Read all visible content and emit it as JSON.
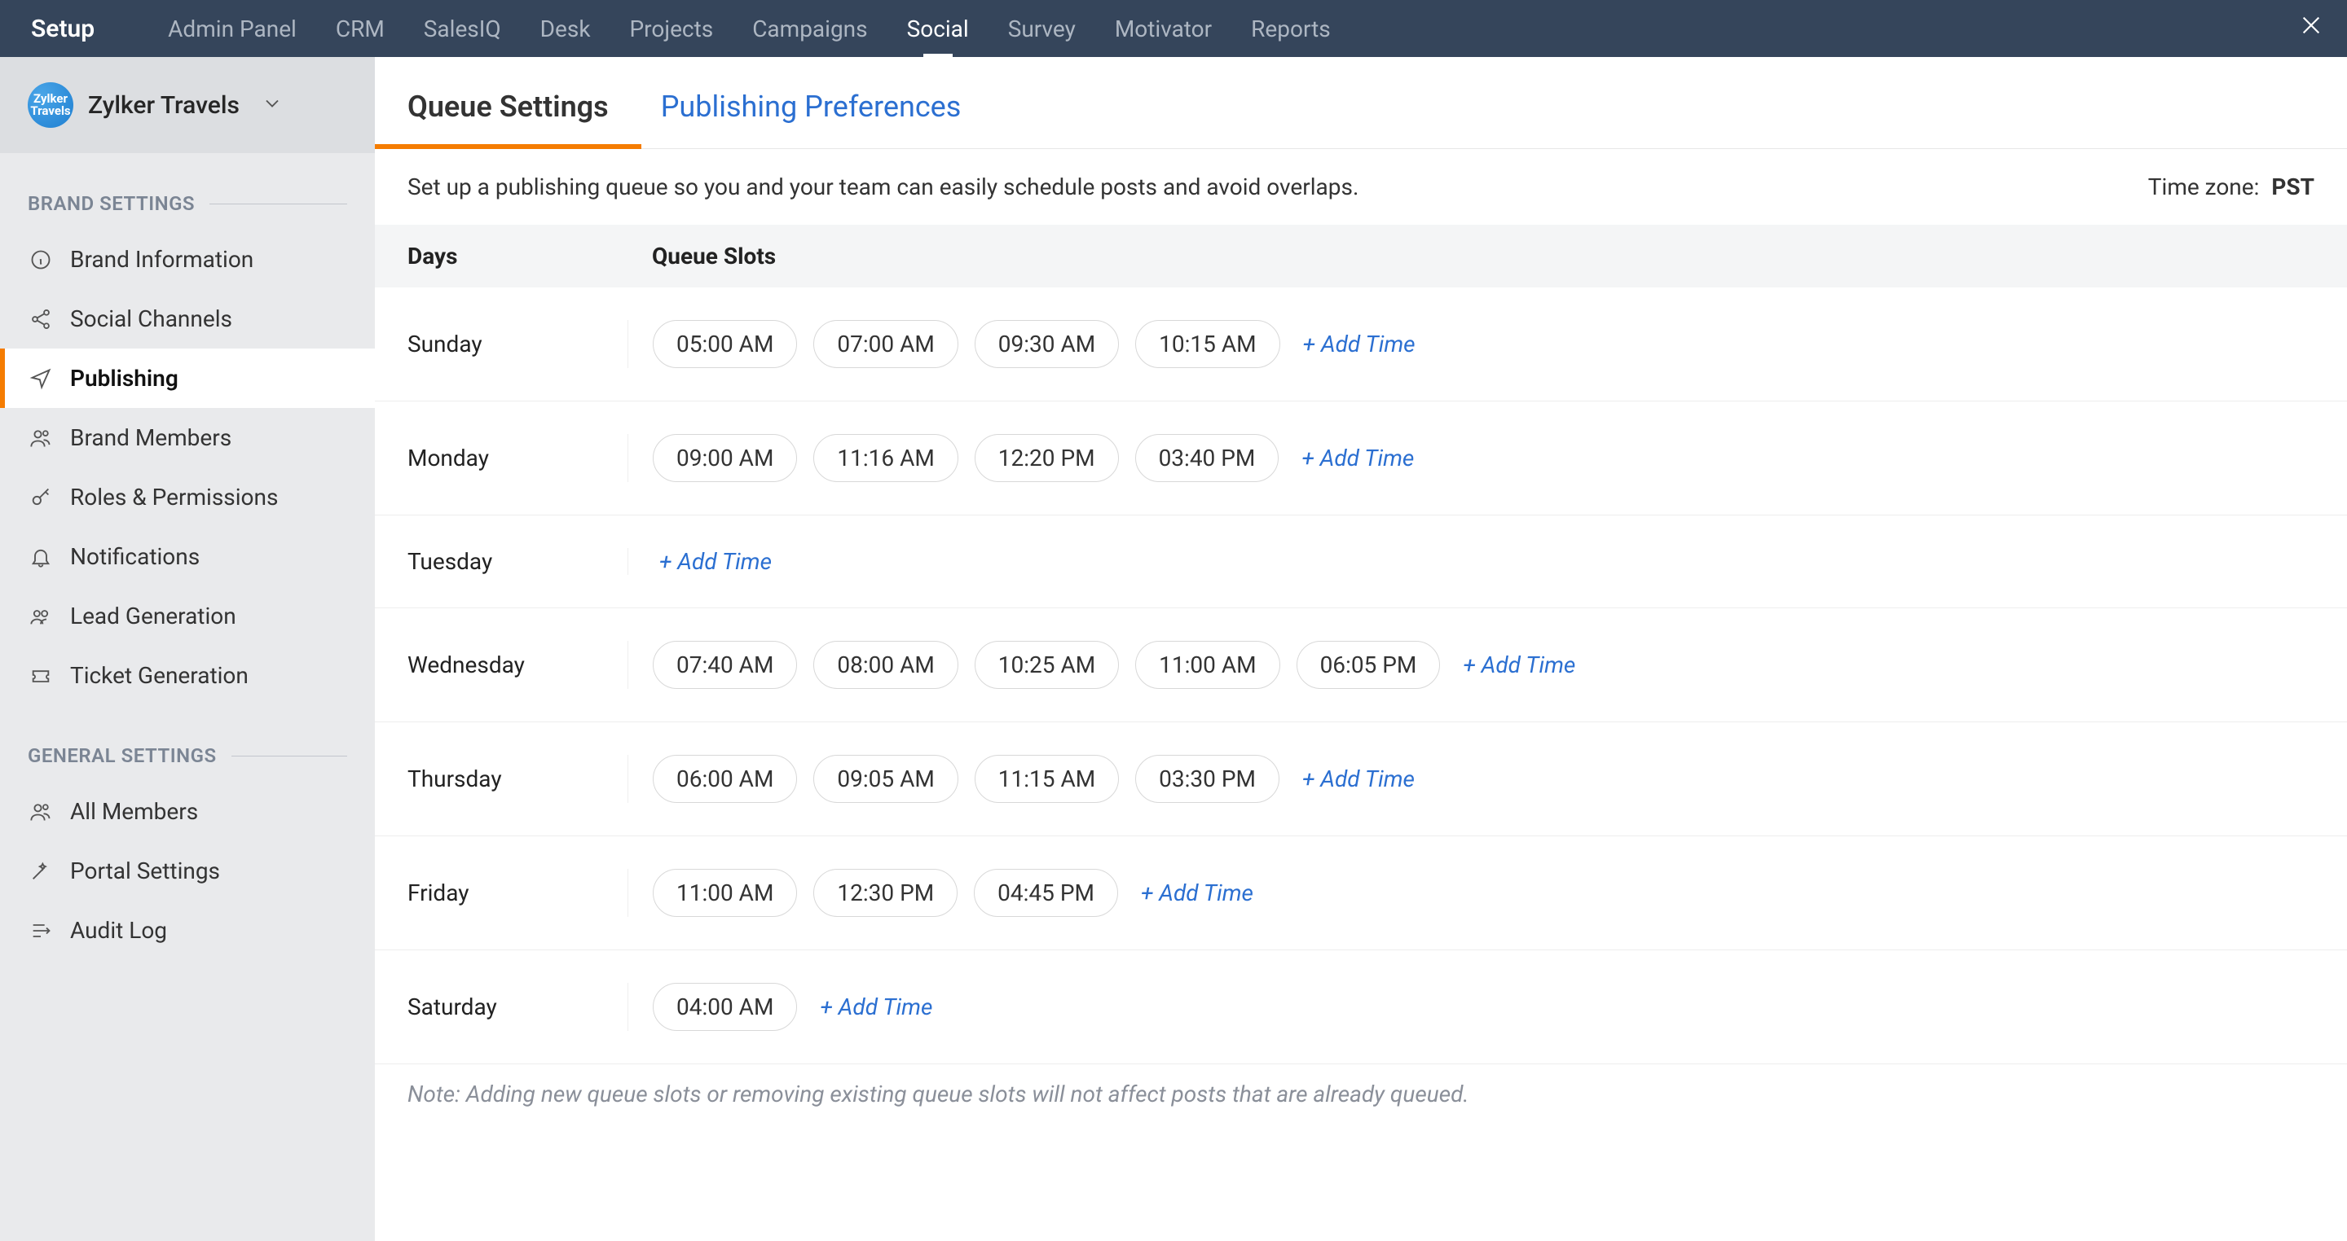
{
  "topbar": {
    "setup": "Setup",
    "items": [
      "Admin Panel",
      "CRM",
      "SalesIQ",
      "Desk",
      "Projects",
      "Campaigns",
      "Social",
      "Survey",
      "Motivator",
      "Reports"
    ],
    "active_index": 6
  },
  "brand": {
    "name": "Zylker Travels",
    "logo_text": "Zylker Travels"
  },
  "sidebar": {
    "section_brand": "BRAND SETTINGS",
    "brand_items": [
      "Brand Information",
      "Social Channels",
      "Publishing",
      "Brand Members",
      "Roles & Permissions",
      "Notifications",
      "Lead Generation",
      "Ticket Generation"
    ],
    "brand_icons": [
      "info-icon",
      "share-icon",
      "send-icon",
      "members-icon",
      "key-icon",
      "bell-icon",
      "people-icon",
      "ticket-icon"
    ],
    "brand_active_index": 2,
    "section_general": "GENERAL SETTINGS",
    "general_items": [
      "All Members",
      "Portal Settings",
      "Audit Log"
    ],
    "general_icons": [
      "members-icon",
      "wand-icon",
      "log-icon"
    ]
  },
  "tabs": {
    "queue": "Queue Settings",
    "pref": "Publishing Preferences"
  },
  "desc": "Set up a publishing queue so you and your team can easily schedule posts and avoid overlaps.",
  "tz": {
    "label": "Time zone:",
    "value": "PST"
  },
  "head": {
    "days": "Days",
    "slots": "Queue Slots"
  },
  "add_time": "+ Add Time",
  "note": "Note: Adding new queue slots or removing existing queue slots will not affect posts that are already queued.",
  "schedule": [
    {
      "day": "Sunday",
      "times": [
        "05:00 AM",
        "07:00 AM",
        "09:30 AM",
        "10:15 AM"
      ]
    },
    {
      "day": "Monday",
      "times": [
        "09:00 AM",
        "11:16 AM",
        "12:20 PM",
        "03:40 PM"
      ]
    },
    {
      "day": "Tuesday",
      "times": []
    },
    {
      "day": "Wednesday",
      "times": [
        "07:40 AM",
        "08:00 AM",
        "10:25 AM",
        "11:00 AM",
        "06:05 PM"
      ]
    },
    {
      "day": "Thursday",
      "times": [
        "06:00 AM",
        "09:05 AM",
        "11:15 AM",
        "03:30 PM"
      ]
    },
    {
      "day": "Friday",
      "times": [
        "11:00 AM",
        "12:30 PM",
        "04:45 PM"
      ]
    },
    {
      "day": "Saturday",
      "times": [
        "04:00 AM"
      ]
    }
  ]
}
